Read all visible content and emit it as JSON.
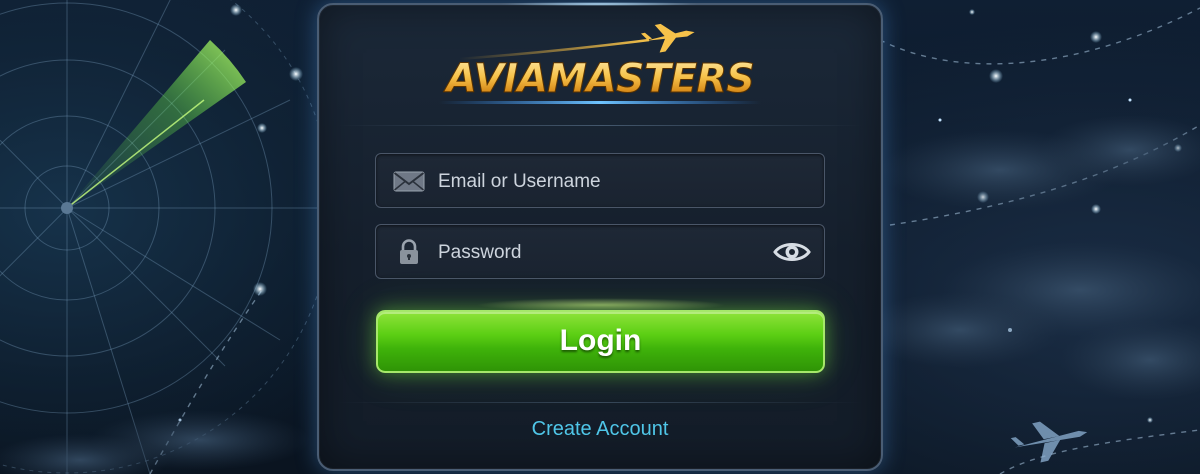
{
  "brand": {
    "logo_text": "AVIAMASTERS"
  },
  "form": {
    "email_placeholder": "Email or Username",
    "password_placeholder": "Password",
    "login_label": "Login",
    "create_account_label": "Create Account"
  },
  "icons": {
    "email": "envelope-icon",
    "password": "lock-icon",
    "toggle_password": "eye-icon",
    "logo_plane": "airplane-icon",
    "radar": "radar-icon",
    "background_plane": "airplane-silhouette-icon"
  },
  "colors": {
    "accent_green": "#5ccf14",
    "link_cyan": "#4fc6e8",
    "logo_gold": "#f2b53a",
    "panel_border": "#4a5d74"
  }
}
